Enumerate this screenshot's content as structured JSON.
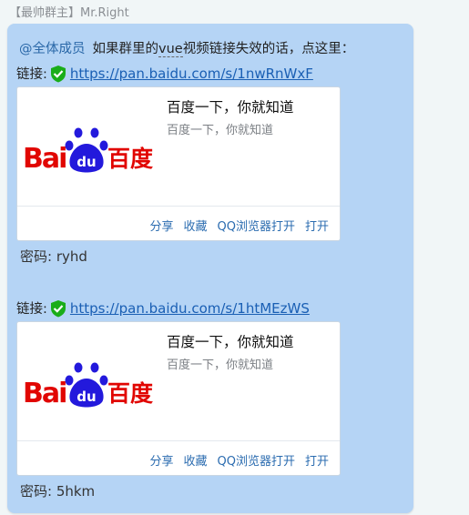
{
  "sender": {
    "name": "【最帅群主】Mr.Right"
  },
  "message": {
    "mention": "@全体成员",
    "text_before": "如果群里的",
    "keyword": "vue",
    "text_after": "视频链接失效的话，点这里：",
    "links": [
      {
        "label": "链接:",
        "url": "https://pan.baidu.com/s/1nwRnWxF",
        "card": {
          "logo_text_left": "Bai",
          "logo_text_paw": "du",
          "logo_text_cn": "百度",
          "title": "百度一下，你就知道",
          "desc": "百度一下，你就知道",
          "actions": {
            "share": "分享",
            "favorite": "收藏",
            "open_qq": "QQ浏览器打开",
            "open": "打开"
          }
        },
        "password": "密码: ryhd"
      },
      {
        "label": "链接:",
        "url": "https://pan.baidu.com/s/1htMEzWS",
        "card": {
          "logo_text_left": "Bai",
          "logo_text_paw": "du",
          "logo_text_cn": "百度",
          "title": "百度一下，你就知道",
          "desc": "百度一下，你就知道",
          "actions": {
            "share": "分享",
            "favorite": "收藏",
            "open_qq": "QQ浏览器打开",
            "open": "打开"
          }
        },
        "password": "密码: 5hkm"
      }
    ]
  },
  "colors": {
    "bubble": "#b5d4f5",
    "link": "#1a5fb4",
    "baidu_red": "#e10602",
    "baidu_blue": "#2319dc",
    "shield": "#1aad19"
  }
}
